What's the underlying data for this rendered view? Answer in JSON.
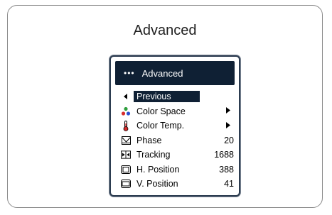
{
  "page": {
    "title": "Advanced"
  },
  "osd": {
    "header": {
      "dots": "•••",
      "title": "Advanced"
    },
    "items": [
      {
        "label": "Previous",
        "icon": "left-arrow-icon",
        "value": "",
        "submenu": false,
        "selected": true
      },
      {
        "label": "Color Space",
        "icon": "color-space-icon",
        "value": "",
        "submenu": true,
        "selected": false
      },
      {
        "label": "Color Temp.",
        "icon": "thermometer-icon",
        "value": "",
        "submenu": true,
        "selected": false
      },
      {
        "label": "Phase",
        "icon": "phase-icon",
        "value": "20",
        "submenu": false,
        "selected": false
      },
      {
        "label": "Tracking",
        "icon": "tracking-icon",
        "value": "1688",
        "submenu": false,
        "selected": false
      },
      {
        "label": "H. Position",
        "icon": "h-position-icon",
        "value": "388",
        "submenu": false,
        "selected": false
      },
      {
        "label": "V. Position",
        "icon": "v-position-icon",
        "value": "41",
        "submenu": false,
        "selected": false
      }
    ],
    "colors": {
      "header_bg": "#0f2034",
      "selection_bg": "#0f2034",
      "frame": "#2c3c50"
    }
  }
}
